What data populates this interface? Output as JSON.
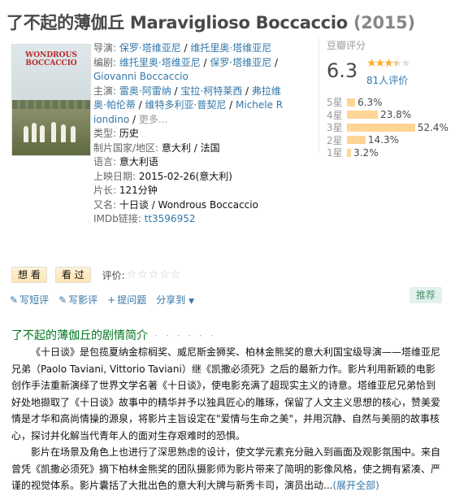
{
  "title": {
    "main": "了不起的薄伽丘 Maraviglioso Boccaccio",
    "year": "(2015)"
  },
  "poster": {
    "title_line1": "WONDROUS",
    "title_line2": "BOCCACCIO"
  },
  "info": {
    "director_label": "导演:",
    "directors": [
      "保罗·塔维亚尼",
      "维托里奥·塔维亚尼"
    ],
    "writer_label": "编剧:",
    "writers": [
      "维托里奥·塔维亚尼",
      "保罗·塔维亚尼",
      "Giovanni Boccaccio"
    ],
    "cast_label": "主演:",
    "cast": [
      "雷奥·阿雷纳",
      "宝拉·柯特莱西",
      "弗拉维奥·帕伦蒂",
      "维特多利亚·普契尼",
      "Michele Riondino"
    ],
    "more": "更多...",
    "genre_label": "类型:",
    "genre": "历史",
    "country_label": "制片国家/地区:",
    "country": "意大利 / 法国",
    "language_label": "语言:",
    "language": "意大利语",
    "release_label": "上映日期:",
    "release": "2015-02-26(意大利)",
    "runtime_label": "片长:",
    "runtime": "121分钟",
    "aka_label": "又名:",
    "aka": "十日谈 / Wondrous Boccaccio",
    "imdb_label": "IMDb链接:",
    "imdb": "tt3596952"
  },
  "rating": {
    "label": "豆瓣评分",
    "score": "6.3",
    "stars_filled": 3.5,
    "votes": "81人评价",
    "distribution": [
      {
        "label": "5星",
        "percent": 6.3,
        "text": "6.3%"
      },
      {
        "label": "4星",
        "percent": 23.8,
        "text": "23.8%"
      },
      {
        "label": "3星",
        "percent": 52.4,
        "text": "52.4%"
      },
      {
        "label": "2星",
        "percent": 14.3,
        "text": "14.3%"
      },
      {
        "label": "1星",
        "percent": 3.2,
        "text": "3.2%"
      }
    ]
  },
  "actions": {
    "want": "想 看",
    "seen": "看 过",
    "rate_label": "评价:"
  },
  "tools": {
    "short_review": "写短评",
    "review": "写影评",
    "ask": "提问题",
    "share": "分享到",
    "recommend": "推荐"
  },
  "summary": {
    "heading": "了不起的薄伽丘的剧情简介",
    "dots": "· · · · · ·",
    "p1": "《十日谈》是包揽夏纳金棕榈奖、威尼斯金狮奖、柏林金熊奖的意大利国宝级导演——塔维亚尼兄弟（Paolo Taviani, Vittorio Taviani）继《凯撒必须死》之后的最新力作。影片利用新颖的电影创作手法重新演绎了世界文学名著《十日谈》，使电影充满了超现实主义的诗意。塔维亚尼兄弟恰到好处地撷取了《十日谈》故事中的精华并予以独具匠心的雕琢，保留了人文主义思想的核心，赞美爱情是才华和高尚情操的源泉，将影片主旨设定在\"爱情与生命之美\"，并用沉静、自然与美丽的故事核心，探讨并化解当代青年人的面对生存艰难时的恐惧。",
    "p2": "影片在场景及角色上也进行了深思熟虑的设计，使文学元素充分融入到画面及观影氛围中。来自曾凭《凯撒必须死》摘下柏林金熊奖的团队摄影师为影片带来了简明的影像风格，使之拥有紧凑、严谨的视觉体系。影片囊括了大批出色的意大利大牌与新秀卡司，演员出动...",
    "expand": "(展开全部)"
  }
}
